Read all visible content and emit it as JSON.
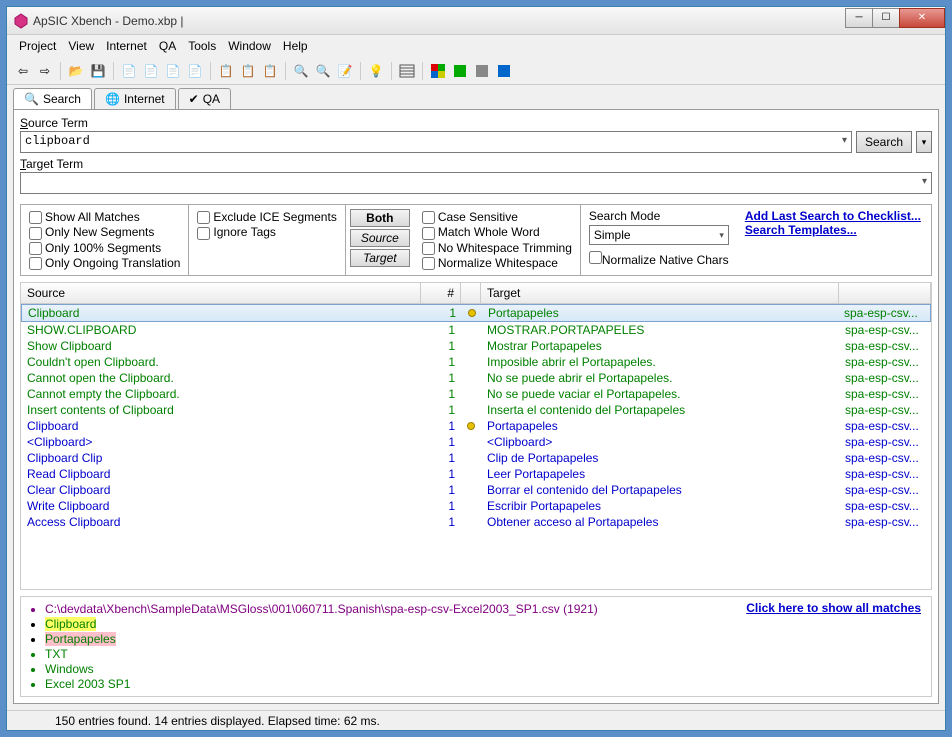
{
  "title": "ApSIC Xbench - Demo.xbp | ",
  "menu": [
    "Project",
    "View",
    "Internet",
    "QA",
    "Tools",
    "Window",
    "Help"
  ],
  "tabs": [
    {
      "label": "Search",
      "icon": "🔍"
    },
    {
      "label": "Internet",
      "icon": "🌐"
    },
    {
      "label": "QA",
      "icon": "✔"
    }
  ],
  "search": {
    "source_label": "Source Term",
    "source_value": "clipboard",
    "target_label": "Target Term",
    "target_value": "",
    "button": "Search"
  },
  "opts1": [
    "Show All Matches",
    "Only New Segments",
    "Only 100% Segments",
    "Only Ongoing Translation"
  ],
  "opts2": [
    "Exclude ICE Segments",
    "Ignore Tags"
  ],
  "btns": {
    "both": "Both",
    "source": "Source",
    "target": "Target"
  },
  "opts3": [
    "Case Sensitive",
    "Match Whole Word",
    "No Whitespace Trimming",
    "Normalize Whitespace"
  ],
  "mode": {
    "label": "Search Mode",
    "value": "Simple",
    "norm": "Normalize Native Chars"
  },
  "links": {
    "add": "Add Last Search to Checklist...",
    "tpl": "Search Templates..."
  },
  "headers": {
    "src": "Source",
    "num": "#",
    "tgt": "Target"
  },
  "rows": [
    {
      "src": "Clipboard",
      "n": "1",
      "dot": true,
      "tgt": "Portapapeles",
      "file": "spa-esp-csv...",
      "cls": "green",
      "sel": true
    },
    {
      "src": "SHOW.CLIPBOARD",
      "n": "1",
      "tgt": "MOSTRAR.PORTAPAPELES",
      "file": "spa-esp-csv...",
      "cls": "green"
    },
    {
      "src": "Show Clipboard",
      "n": "1",
      "tgt": "Mostrar Portapapeles",
      "file": "spa-esp-csv...",
      "cls": "green"
    },
    {
      "src": "Couldn't open Clipboard.",
      "n": "1",
      "tgt": "Imposible abrir el Portapapeles.",
      "file": "spa-esp-csv...",
      "cls": "green"
    },
    {
      "src": "Cannot open the Clipboard.",
      "n": "1",
      "tgt": "No se puede abrir el Portapapeles.",
      "file": "spa-esp-csv...",
      "cls": "green"
    },
    {
      "src": "Cannot empty the Clipboard.",
      "n": "1",
      "tgt": "No se puede vaciar el Portapapeles.",
      "file": "spa-esp-csv...",
      "cls": "green"
    },
    {
      "src": "Insert contents of Clipboard",
      "n": "1",
      "tgt": "Inserta el contenido del Portapapeles",
      "file": "spa-esp-csv...",
      "cls": "green"
    },
    {
      "src": "Clipboard",
      "n": "1",
      "dot": true,
      "tgt": "Portapapeles",
      "file": "spa-esp-csv...",
      "cls": "blue"
    },
    {
      "src": "<Clipboard>",
      "n": "1",
      "tgt": "<Clipboard>",
      "file": "spa-esp-csv...",
      "cls": "blue"
    },
    {
      "src": "Clipboard Clip",
      "n": "1",
      "tgt": "Clip de Portapapeles",
      "file": "spa-esp-csv...",
      "cls": "blue"
    },
    {
      "src": "Read Clipboard",
      "n": "1",
      "tgt": "Leer Portapapeles",
      "file": "spa-esp-csv...",
      "cls": "blue"
    },
    {
      "src": "Clear Clipboard",
      "n": "1",
      "tgt": "Borrar el contenido del Portapapeles",
      "file": "spa-esp-csv...",
      "cls": "blue"
    },
    {
      "src": "Write Clipboard",
      "n": "1",
      "tgt": "Escribir Portapapeles",
      "file": "spa-esp-csv...",
      "cls": "blue"
    },
    {
      "src": "Access Clipboard",
      "n": "1",
      "tgt": "Obtener acceso al Portapapeles",
      "file": "spa-esp-csv...",
      "cls": "blue"
    }
  ],
  "detail": {
    "path": "C:\\devdata\\Xbench\\SampleData\\MSGloss\\001\\060711.Spanish\\spa-esp-csv-Excel2003_SP1.csv (1921)",
    "src": "Clipboard",
    "tgt": "Portapapeles",
    "fmt": "TXT",
    "os": "Windows",
    "app": "Excel 2003 SP1",
    "link": "Click here to show all matches"
  },
  "status": "150 entries found. 14 entries displayed. Elapsed time: 62 ms."
}
